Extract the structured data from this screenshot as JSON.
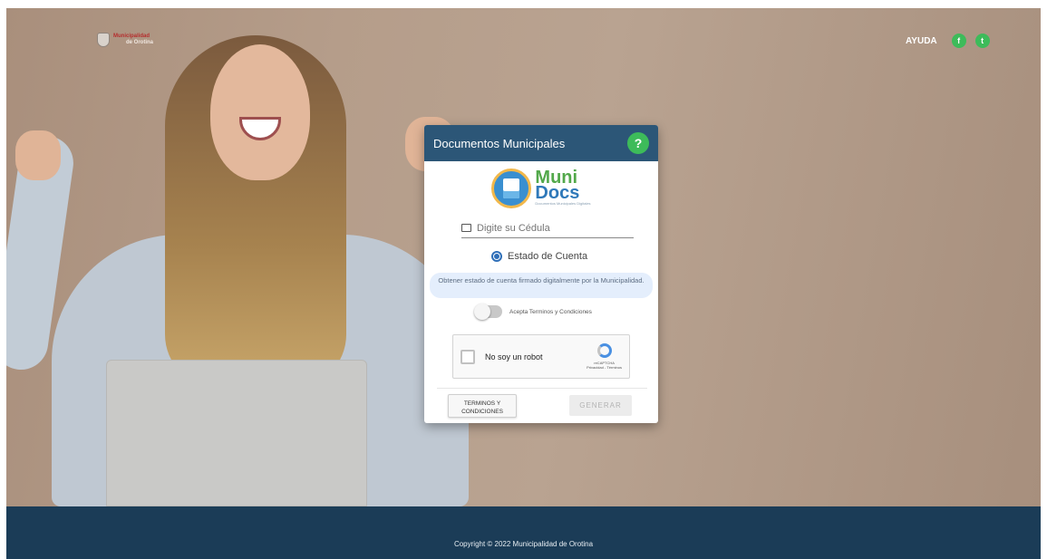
{
  "header": {
    "logo": {
      "name": "Municipalidad",
      "subname": "de Orotina",
      "icon": "municipal-crest-icon"
    },
    "help_label": "AYUDA",
    "social": [
      {
        "name": "facebook-icon",
        "glyph": "f",
        "color": "#3dbb5a"
      },
      {
        "name": "twitter-icon",
        "glyph": "t",
        "color": "#3dbb5a"
      }
    ]
  },
  "card": {
    "title": "Documentos Municipales",
    "help_icon": "?",
    "brand": {
      "line1": "Muni",
      "line2": "Docs",
      "tagline": "Documentos Municipales Digitales"
    },
    "cedula": {
      "placeholder": "Digite su Cédula",
      "value": "",
      "icon": "id-card-icon"
    },
    "option": {
      "label": "Estado de Cuenta",
      "selected": true
    },
    "info_text": "Obtener estado de cuenta firmado digitalmente por la Municipalidad.",
    "terms_toggle": {
      "label": "Acepta Terminos y Condiciones",
      "checked": false
    },
    "captcha": {
      "label": "No soy un robot",
      "brand": "reCAPTCHA",
      "links": "Privacidad - Términos"
    },
    "buttons": {
      "terms": "TERMINOS Y CONDICIONES",
      "generate": "GENERAR"
    }
  },
  "footer": {
    "copyright": "Copyright © 2022 Municipalidad de Orotina"
  },
  "colors": {
    "header_blue": "#2c5677",
    "footer_blue": "#1b3c57",
    "accent_green": "#3dbb5a",
    "radio_blue": "#2f6fb8"
  }
}
